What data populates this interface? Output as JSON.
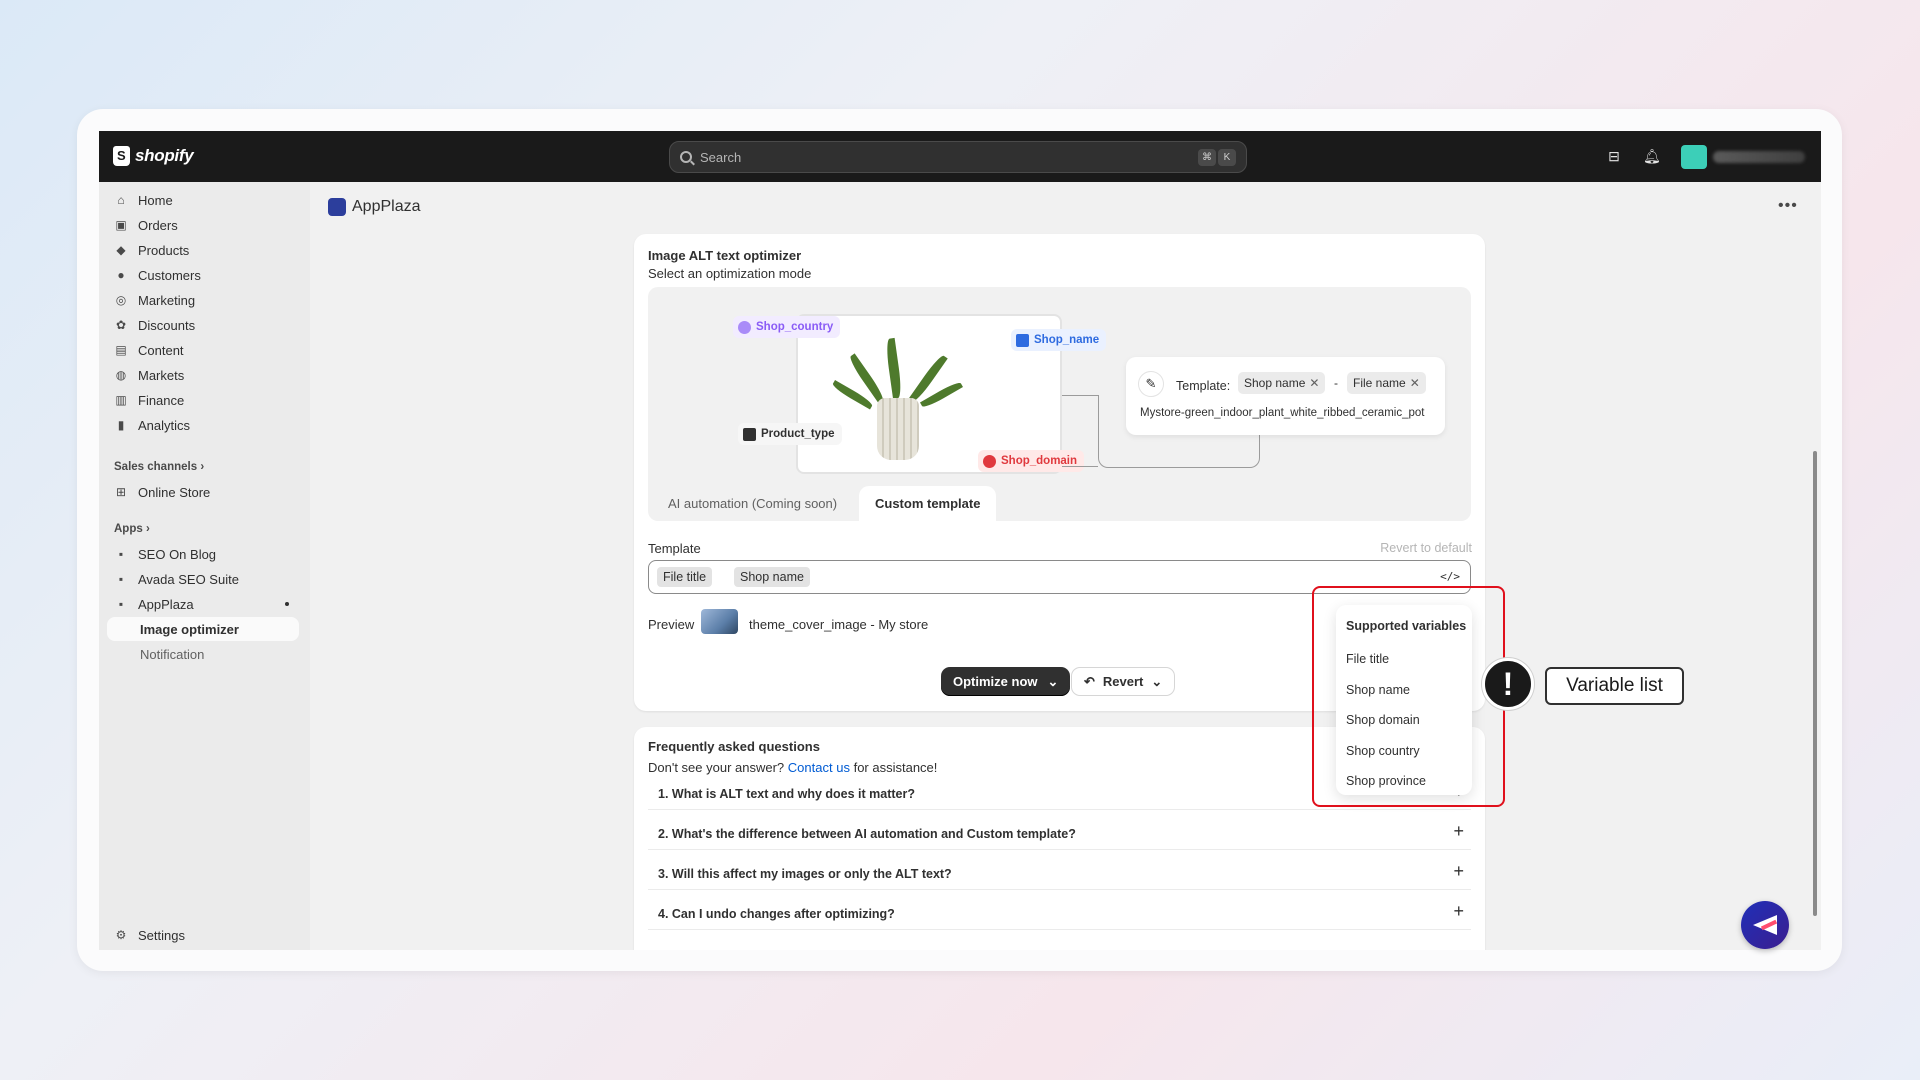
{
  "topbar": {
    "logo_text": "shopify",
    "search_placeholder": "Search",
    "shortcut_cmd": "⌘",
    "shortcut_key": "K"
  },
  "sidebar": {
    "items": [
      {
        "label": "Home",
        "icon": "home-icon"
      },
      {
        "label": "Orders",
        "icon": "orders-icon"
      },
      {
        "label": "Products",
        "icon": "tag-icon"
      },
      {
        "label": "Customers",
        "icon": "person-icon"
      },
      {
        "label": "Marketing",
        "icon": "target-icon"
      },
      {
        "label": "Discounts",
        "icon": "discount-icon"
      },
      {
        "label": "Content",
        "icon": "content-icon"
      },
      {
        "label": "Markets",
        "icon": "globe-icon"
      },
      {
        "label": "Finance",
        "icon": "bank-icon"
      },
      {
        "label": "Analytics",
        "icon": "chart-icon"
      }
    ],
    "sales_channels_label": "Sales channels",
    "online_store_label": "Online Store",
    "apps_label": "Apps",
    "apps": [
      {
        "label": "SEO On Blog"
      },
      {
        "label": "Avada SEO Suite"
      },
      {
        "label": "AppPlaza"
      }
    ],
    "sub_items": [
      "Image optimizer",
      "Notification"
    ],
    "settings_label": "Settings"
  },
  "header": {
    "title": "AppPlaza"
  },
  "optimizer": {
    "title": "Image ALT text optimizer",
    "subtitle": "Select an optimization mode",
    "chips": {
      "shop_country": "Shop_country",
      "shop_name": "Shop_name",
      "product_type": "Product_type",
      "shop_domain": "Shop_domain"
    },
    "template_card": {
      "label": "Template:",
      "token_1": "Shop name",
      "dash": "-",
      "token_2": "File name",
      "output": "Mystore-green_indoor_plant_white_ribbed_ceramic_pot"
    },
    "tabs": [
      "AI automation (Coming soon)",
      "Custom template"
    ],
    "template_label": "Template",
    "revert_default": "Revert to default",
    "input_tokens": [
      "File title",
      "Shop name"
    ],
    "input_dash": "-",
    "preview_label": "Preview",
    "preview_value": "theme_cover_image - My store",
    "optimize_button": "Optimize now",
    "revert_button": "Revert"
  },
  "variables": {
    "title": "Supported variables",
    "items": [
      "File title",
      "Shop name",
      "Shop domain",
      "Shop country",
      "Shop province"
    ]
  },
  "faq": {
    "title": "Frequently asked questions",
    "sub_prefix": "Don't see your answer?",
    "sub_link": "Contact us",
    "sub_suffix": "for assistance!",
    "questions": [
      "1. What is ALT text and why does it matter?",
      "2. What's the difference between AI automation and Custom template?",
      "3. Will this affect my images or only the ALT text?",
      "4. Can I undo changes after optimizing?"
    ]
  },
  "annotation": {
    "callout_label": "Variable list",
    "warn_symbol": "!"
  },
  "colors": {
    "highlight": "#e0101c",
    "link": "#005bd3",
    "topbar": "#1a1a1a"
  }
}
